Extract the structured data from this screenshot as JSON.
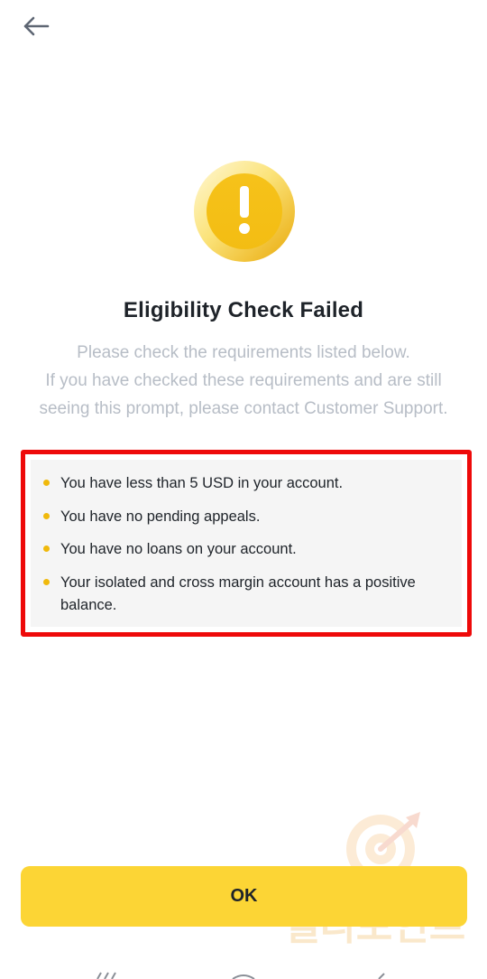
{
  "header": {
    "back_icon": "arrow-left-icon"
  },
  "status": {
    "icon": "exclamation-circle-icon",
    "accent_color": "#F0B90B",
    "title": "Eligibility Check Failed",
    "message_lines": [
      "Please check the requirements listed below.",
      "If you have checked these requirements and are still",
      "seeing this prompt, please contact Customer Support."
    ]
  },
  "requirements": {
    "highlight_color": "#EE0A0A",
    "items": [
      "You have less than 5 USD in your account.",
      "You have no pending appeals.",
      "You have no loans on your account.",
      "Your isolated and cross margin account has a positive balance."
    ]
  },
  "footer": {
    "ok_label": "OK",
    "button_color": "#FCD535"
  },
  "watermark": {
    "text": "랠리포인트"
  }
}
